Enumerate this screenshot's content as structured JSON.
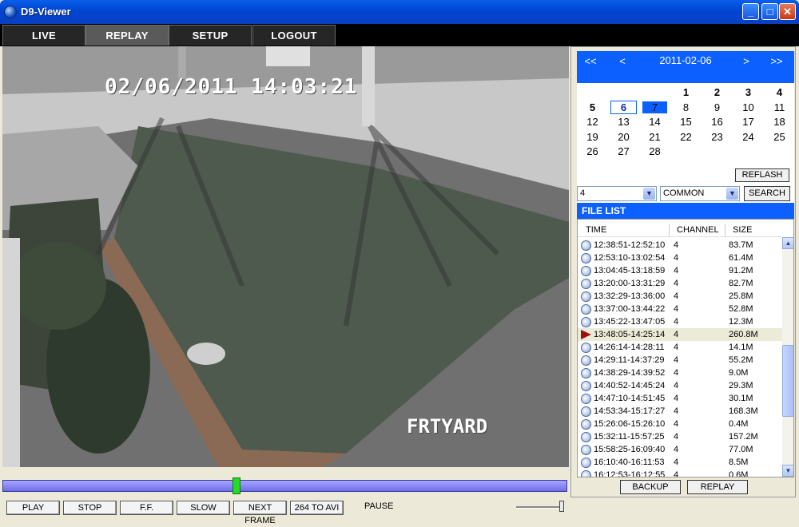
{
  "window": {
    "title": "D9-Viewer",
    "min": "_",
    "max": "□",
    "close": "✕"
  },
  "menu": [
    {
      "label": "LIVE",
      "active": false
    },
    {
      "label": "REPLAY",
      "active": true
    },
    {
      "label": "SETUP",
      "active": false
    },
    {
      "label": "LOGOUT",
      "active": false
    }
  ],
  "video": {
    "timestamp": "02/06/2011 14:03:21",
    "camera_label": "FRTYARD"
  },
  "playback": {
    "progress": 0.415,
    "buttons": [
      "PLAY",
      "STOP",
      "F.F.",
      "SLOW",
      "NEXT FRAME",
      "264 TO AVI"
    ],
    "status": "PAUSE",
    "volume": 0.95
  },
  "calendar": {
    "nav_prev_year": "<<",
    "nav_prev_month": "<",
    "month_label": "2011-02-06",
    "nav_next_month": ">",
    "nav_next_year": ">>",
    "first_weekday_col": 2,
    "days": [
      "1",
      "2",
      "3",
      "4",
      "5",
      "6",
      "7",
      "8",
      "9",
      "10",
      "11",
      "12",
      "13",
      "14",
      "15",
      "16",
      "17",
      "18",
      "19",
      "20",
      "21",
      "22",
      "23",
      "24",
      "25",
      "26",
      "27",
      "28"
    ],
    "bold_days": [
      "1",
      "2",
      "3",
      "4",
      "5"
    ],
    "selected_day": "6",
    "highlight_day": "7",
    "reflash_label": "REFLASH"
  },
  "search": {
    "channel": "4",
    "type": "COMMON",
    "button": "SEARCH"
  },
  "file_list": {
    "title": "FILE LIST",
    "columns": [
      "TIME",
      "CHANNEL",
      "SIZE"
    ],
    "rows": [
      {
        "time": "12:38:51-12:52:10",
        "channel": "4",
        "size": "83.7M"
      },
      {
        "time": "12:53:10-13:02:54",
        "channel": "4",
        "size": "61.4M"
      },
      {
        "time": "13:04:45-13:18:59",
        "channel": "4",
        "size": "91.2M"
      },
      {
        "time": "13:20:00-13:31:29",
        "channel": "4",
        "size": "82.7M"
      },
      {
        "time": "13:32:29-13:36:00",
        "channel": "4",
        "size": "25.8M"
      },
      {
        "time": "13:37:00-13:44:22",
        "channel": "4",
        "size": "52.8M"
      },
      {
        "time": "13:45:22-13:47:05",
        "channel": "4",
        "size": "12.3M"
      },
      {
        "time": "13:48:05-14:25:14",
        "channel": "4",
        "size": "260.8M",
        "selected": true
      },
      {
        "time": "14:26:14-14:28:11",
        "channel": "4",
        "size": "14.1M"
      },
      {
        "time": "14:29:11-14:37:29",
        "channel": "4",
        "size": "55.2M"
      },
      {
        "time": "14:38:29-14:39:52",
        "channel": "4",
        "size": "9.0M"
      },
      {
        "time": "14:40:52-14:45:24",
        "channel": "4",
        "size": "29.3M"
      },
      {
        "time": "14:47:10-14:51:45",
        "channel": "4",
        "size": "30.1M"
      },
      {
        "time": "14:53:34-15:17:27",
        "channel": "4",
        "size": "168.3M"
      },
      {
        "time": "15:26:06-15:26:10",
        "channel": "4",
        "size": "0.4M"
      },
      {
        "time": "15:32:11-15:57:25",
        "channel": "4",
        "size": "157.2M"
      },
      {
        "time": "15:58:25-16:09:40",
        "channel": "4",
        "size": "77.0M"
      },
      {
        "time": "16:10:40-16:11:53",
        "channel": "4",
        "size": "8.5M"
      },
      {
        "time": "16:12:53-16:12:55",
        "channel": "4",
        "size": "0.6M"
      }
    ],
    "backup_label": "BACKUP",
    "replay_label": "REPLAY"
  }
}
